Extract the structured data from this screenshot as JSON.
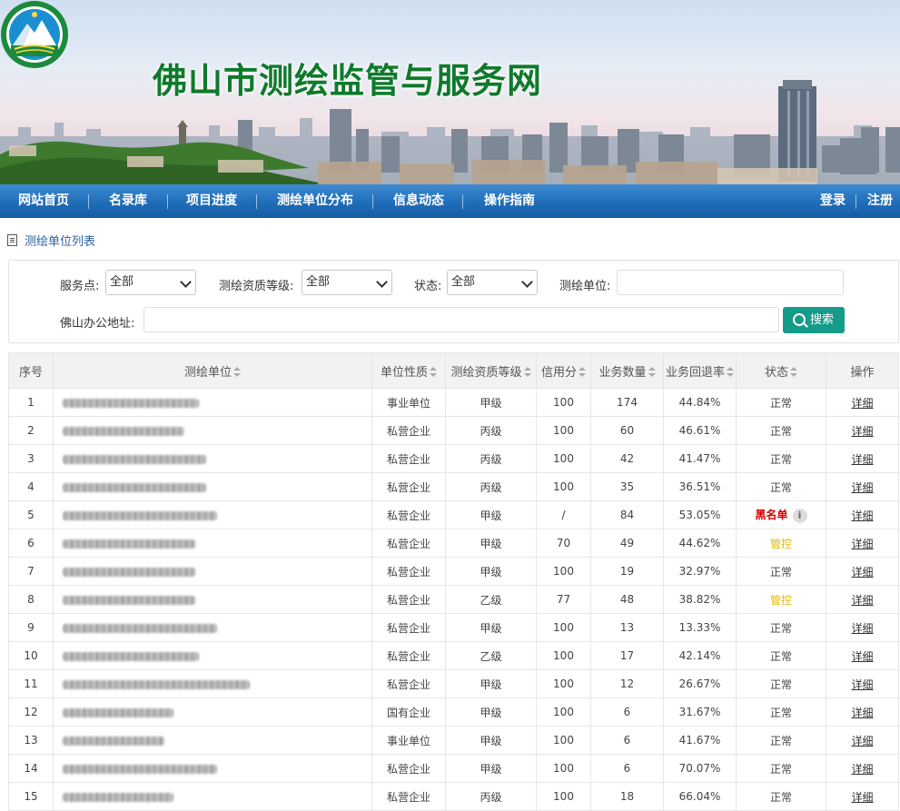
{
  "site": {
    "title": "佛山市测绘监管与服务网"
  },
  "nav": {
    "items": [
      "网站首页",
      "名录库",
      "项目进度",
      "测绘单位分布",
      "信息动态",
      "操作指南"
    ],
    "login": "登录",
    "register": "注册"
  },
  "breadcrumb": "测绘单位列表",
  "filters": {
    "service_point_label": "服务点:",
    "service_point_value": "全部",
    "qualification_label": "测绘资质等级:",
    "qualification_value": "全部",
    "status_label": "状态:",
    "status_value": "全部",
    "unit_label": "测绘单位:",
    "unit_value": "",
    "address_label": "佛山办公地址:",
    "address_value": "",
    "search_button": "搜索"
  },
  "table": {
    "headers": [
      "序号",
      "测绘单位",
      "单位性质",
      "测绘资质等级",
      "信用分",
      "业务数量",
      "业务回退率",
      "状态",
      "操作"
    ],
    "rows": [
      {
        "no": "1",
        "nature": "事业单位",
        "level": "甲级",
        "credit": "100",
        "count": "174",
        "rate": "44.84%",
        "status": "正常",
        "action": "详细"
      },
      {
        "no": "2",
        "nature": "私营企业",
        "level": "丙级",
        "credit": "100",
        "count": "60",
        "rate": "46.61%",
        "status": "正常",
        "action": "详细"
      },
      {
        "no": "3",
        "nature": "私营企业",
        "level": "丙级",
        "credit": "100",
        "count": "42",
        "rate": "41.47%",
        "status": "正常",
        "action": "详细"
      },
      {
        "no": "4",
        "nature": "私营企业",
        "level": "丙级",
        "credit": "100",
        "count": "35",
        "rate": "36.51%",
        "status": "正常",
        "action": "详细"
      },
      {
        "no": "5",
        "nature": "私营企业",
        "level": "甲级",
        "credit": "/",
        "count": "84",
        "rate": "53.05%",
        "status": "黑名单",
        "action": "详细"
      },
      {
        "no": "6",
        "nature": "私营企业",
        "level": "甲级",
        "credit": "70",
        "count": "49",
        "rate": "44.62%",
        "status": "管控",
        "action": "详细"
      },
      {
        "no": "7",
        "nature": "私营企业",
        "level": "甲级",
        "credit": "100",
        "count": "19",
        "rate": "32.97%",
        "status": "正常",
        "action": "详细"
      },
      {
        "no": "8",
        "nature": "私营企业",
        "level": "乙级",
        "credit": "77",
        "count": "48",
        "rate": "38.82%",
        "status": "管控",
        "action": "详细"
      },
      {
        "no": "9",
        "nature": "私营企业",
        "level": "甲级",
        "credit": "100",
        "count": "13",
        "rate": "13.33%",
        "status": "正常",
        "action": "详细"
      },
      {
        "no": "10",
        "nature": "私营企业",
        "level": "乙级",
        "credit": "100",
        "count": "17",
        "rate": "42.14%",
        "status": "正常",
        "action": "详细"
      },
      {
        "no": "11",
        "nature": "私营企业",
        "level": "甲级",
        "credit": "100",
        "count": "12",
        "rate": "26.67%",
        "status": "正常",
        "action": "详细"
      },
      {
        "no": "12",
        "nature": "国有企业",
        "level": "甲级",
        "credit": "100",
        "count": "6",
        "rate": "31.67%",
        "status": "正常",
        "action": "详细"
      },
      {
        "no": "13",
        "nature": "事业单位",
        "level": "甲级",
        "credit": "100",
        "count": "6",
        "rate": "41.67%",
        "status": "正常",
        "action": "详细"
      },
      {
        "no": "14",
        "nature": "私营企业",
        "level": "甲级",
        "credit": "100",
        "count": "6",
        "rate": "70.07%",
        "status": "正常",
        "action": "详细"
      },
      {
        "no": "15",
        "nature": "私营企业",
        "level": "丙级",
        "credit": "100",
        "count": "18",
        "rate": "66.04%",
        "status": "正常",
        "action": "详细"
      }
    ]
  },
  "colors": {
    "nav_blue": "#1f6db8",
    "title_green": "#0f7a2c",
    "search_teal": "#159b8a",
    "blacklist_red": "#d40000",
    "control_yellow": "#e6b800"
  },
  "icons": {
    "logo": "bureau-emblem-icon",
    "doc": "document-icon",
    "search": "search-icon",
    "info": "info-icon"
  }
}
